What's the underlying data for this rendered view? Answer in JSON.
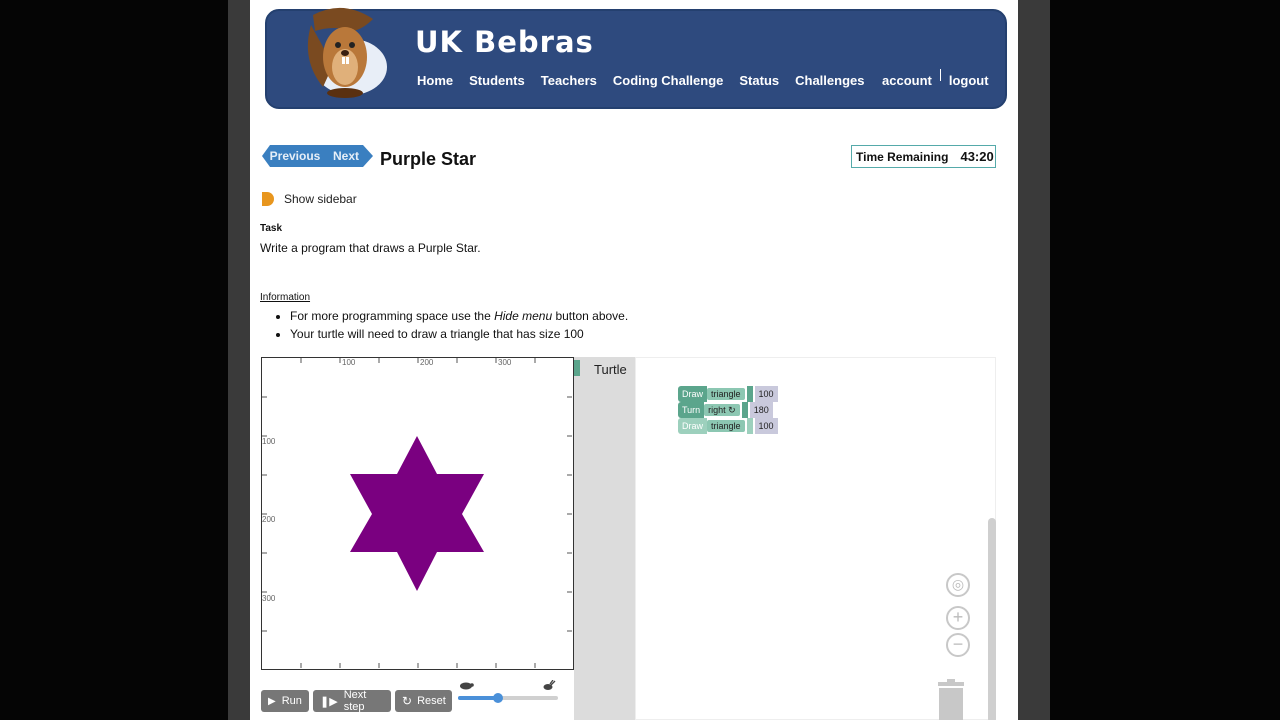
{
  "site": {
    "title": "UK Bebras"
  },
  "nav": {
    "items": [
      "Home",
      "Students",
      "Teachers",
      "Coding Challenge",
      "Status",
      "Challenges"
    ],
    "account": "account",
    "logout": "logout"
  },
  "task_nav": {
    "previous": "Previous",
    "next": "Next",
    "title": "Purple Star"
  },
  "timer": {
    "label": "Time Remaining",
    "value": "43:20"
  },
  "sidebar_toggle": "Show sidebar",
  "task": {
    "label": "Task",
    "text": "Write a program that draws a Purple Star."
  },
  "information": {
    "label": "Information",
    "bullet1_pre": "For more programming space use the ",
    "bullet1_em": "Hide menu",
    "bullet1_post": " button above.",
    "bullet2": "Your turtle will need to draw a triangle that has size 100"
  },
  "canvas": {
    "x_ticks": [
      "100",
      "200",
      "300"
    ],
    "y_ticks": [
      "100",
      "200",
      "300"
    ],
    "shape_color": "#7a0080"
  },
  "toolbox": {
    "category": "Turtle"
  },
  "blocks": [
    {
      "kw": "Draw",
      "dd": "triangle",
      "num": "100"
    },
    {
      "kw": "Turn",
      "dd": "right ↻",
      "num": "180"
    },
    {
      "kw": "Draw",
      "dd": "triangle",
      "num": "100"
    }
  ],
  "controls": {
    "run": "Run",
    "next_step": "Next step",
    "reset": "Reset",
    "speed_level": 0.4
  },
  "colors": {
    "header_bg": "#2e4a7e",
    "nav_btn": "#3a7fc0",
    "block_green": "#5ba58c",
    "accent_orange": "#e8961e"
  }
}
